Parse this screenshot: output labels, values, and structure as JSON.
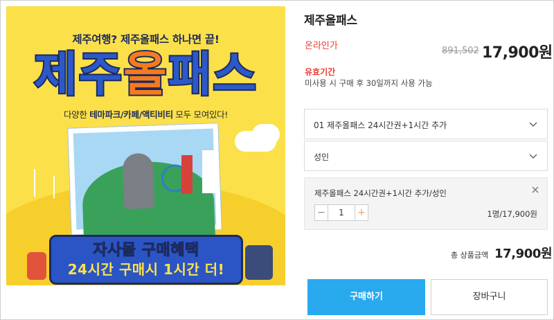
{
  "banner": {
    "headline": "제주여행? 제주올패스 하나면 끝!",
    "brand_part1": "제주",
    "brand_part2": "올",
    "brand_part3": "패스",
    "subline_prefix": "다양한",
    "subline_highlight": "테마파크/카페/액티비티",
    "subline_suffix": "모두 모여있다!",
    "ribbon_line1": "자사몰 구매혜택",
    "ribbon_line2": "24시간 구매시 1시간 더!",
    "colors": {
      "background": "#fbe04a",
      "brand_blue": "#2d59c8",
      "brand_orange": "#f47b20",
      "ribbon": "#2b55c4"
    }
  },
  "product": {
    "title": "제주올패스",
    "price_label": "온라인가",
    "original_price": "891,502",
    "sale_price": "17,900원",
    "validity_label": "유효기간",
    "validity_text": "미사용 시 구매 후 30일까지 사용 가능"
  },
  "options": {
    "select1_value": "01 제주올패스 24시간권+1시간 추가",
    "select2_value": "성인",
    "selected_item": {
      "name": "제주올패스 24시간권+1시간 추가/성인",
      "quantity": "1",
      "minus": "−",
      "plus": "+",
      "line_total": "1명/17,900원"
    }
  },
  "summary": {
    "total_label": "총 상품금액",
    "total_value": "17,900원"
  },
  "actions": {
    "buy_label": "구매하기",
    "cart_label": "장바구니"
  },
  "theme": {
    "accent": "#29a9ee",
    "price_red": "#e93c2e"
  }
}
